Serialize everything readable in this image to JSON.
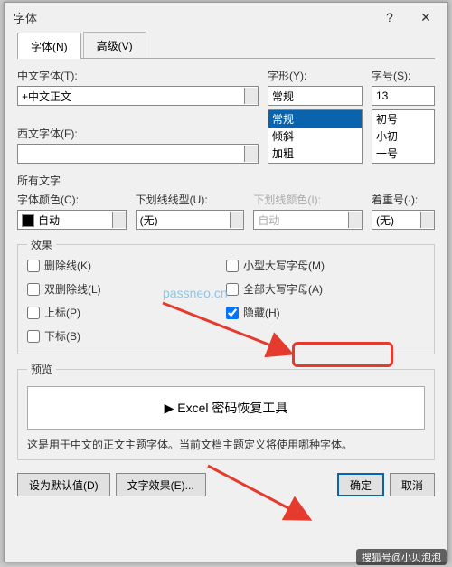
{
  "dialog": {
    "title": "字体"
  },
  "tabs": {
    "font": "字体(N)",
    "advanced": "高级(V)"
  },
  "labels": {
    "cnFont": "中文字体(T):",
    "westFont": "西文字体(F):",
    "style": "字形(Y):",
    "size": "字号(S):",
    "allText": "所有文字",
    "fontColor": "字体颜色(C):",
    "underlineStyle": "下划线线型(U):",
    "underlineColor": "下划线颜色(I):",
    "emphasis": "着重号(·):",
    "effects": "效果",
    "preview": "预览"
  },
  "values": {
    "cnFont": "+中文正文",
    "westFont": "",
    "style": "常规",
    "size": "13",
    "fontColor": "自动",
    "underlineStyle": "(无)",
    "underlineColor": "自动",
    "emphasis": "(无)"
  },
  "styleList": [
    "常规",
    "倾斜",
    "加粗"
  ],
  "sizeList": [
    "初号",
    "小初",
    "一号"
  ],
  "effects": {
    "strike": "删除线(K)",
    "dblStrike": "双删除线(L)",
    "super": "上标(P)",
    "sub": "下标(B)",
    "smallCaps": "小型大写字母(M)",
    "allCaps": "全部大写字母(A)",
    "hidden": "隐藏(H)"
  },
  "checked": {
    "hidden": true
  },
  "previewText": "▶  Excel 密码恢复工具",
  "previewNote": "这是用于中文的正文主题字体。当前文档主题定义将使用哪种字体。",
  "buttons": {
    "setDefault": "设为默认值(D)",
    "textEffects": "文字效果(E)...",
    "ok": "确定",
    "cancel": "取消"
  },
  "watermark": "passneo.cn",
  "credit": "搜狐号@小贝泡泡"
}
